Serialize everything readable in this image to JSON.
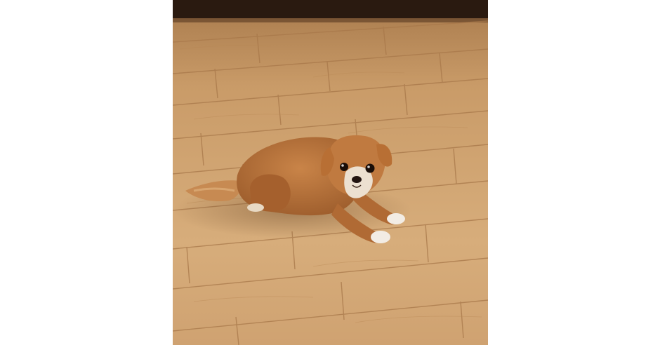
{
  "image": {
    "subject": "dog-lying-on-wooden-floor",
    "colors": {
      "page_background": "#ffffff",
      "floor_light": "#d9b07e",
      "floor_mid": "#c89b66",
      "floor_dark": "#a9794a",
      "floor_shadow": "#6b4a2c",
      "baseboard": "#2a1a10",
      "fur_main": "#b06a34",
      "fur_light": "#d39a5e",
      "fur_white": "#f2ece4",
      "eye": "#1a0e08"
    }
  }
}
